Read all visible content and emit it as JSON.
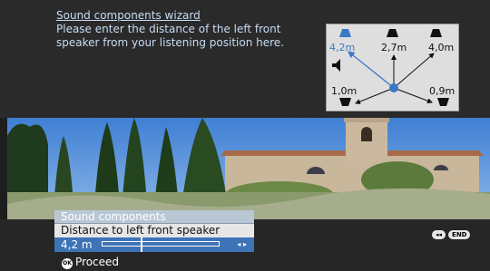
{
  "wizard": {
    "title": "Sound components wizard",
    "instruction": "Please enter the distance of the left front speaker from your listening position here."
  },
  "diagram": {
    "speakers": [
      {
        "id": "front-left",
        "distance": "4,2m",
        "selected": true
      },
      {
        "id": "center",
        "distance": "2,7m",
        "selected": false
      },
      {
        "id": "front-right",
        "distance": "4,0m",
        "selected": false
      },
      {
        "id": "rear-left",
        "distance": "1,0m",
        "selected": false
      },
      {
        "id": "rear-right",
        "distance": "0,9m",
        "selected": false
      }
    ],
    "colors": {
      "selected": "#3a78c8",
      "default": "#111111",
      "background": "#dedede"
    }
  },
  "menu": {
    "header": "Sound components",
    "item": "Distance to left front speaker",
    "value": "4,2 m",
    "slider_level_fraction": 0.33
  },
  "footer": {
    "proceed_label": "Proceed",
    "ok_icon": "OK",
    "rewind_icon": "◂◂",
    "end_label": "END"
  }
}
